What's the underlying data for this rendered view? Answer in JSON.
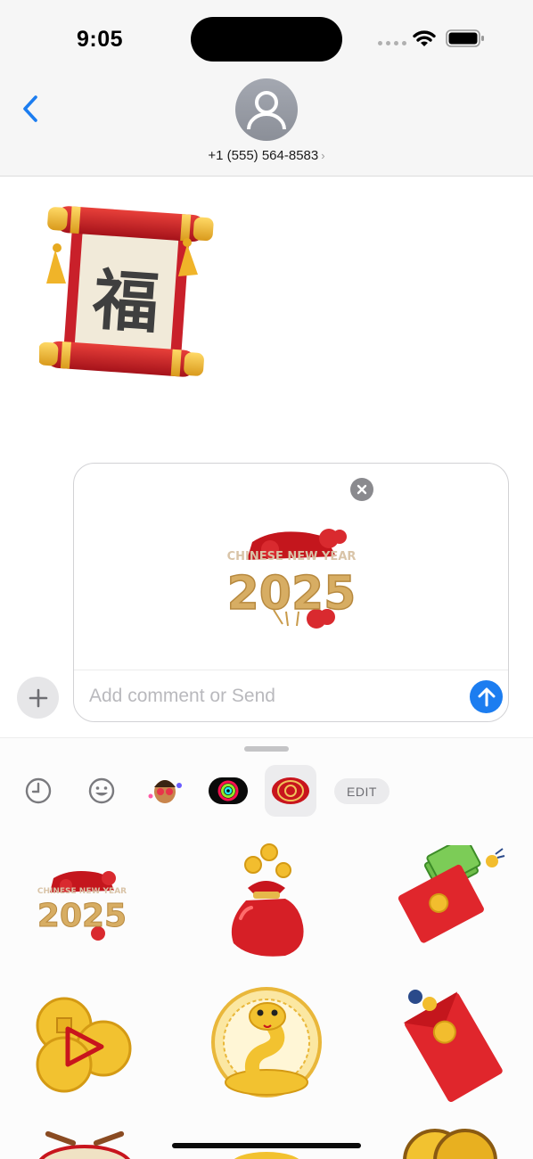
{
  "status_bar": {
    "time": "9:05"
  },
  "header": {
    "contact": "+1 (555) 564-8583"
  },
  "conversation": {
    "sent_sticker": {
      "glyph": "福"
    }
  },
  "compose": {
    "placeholder": "Add comment or Send",
    "value": "",
    "attachment": {
      "line1": "CHINESE NEW YEAR",
      "line2": "2025"
    }
  },
  "drawer": {
    "tabs": [
      {
        "icon": "recents-clock-icon",
        "selected": false
      },
      {
        "icon": "emoji-smiley-icon",
        "selected": false
      },
      {
        "icon": "memoji-icon",
        "selected": false
      },
      {
        "icon": "activity-rings-icon",
        "selected": false
      },
      {
        "icon": "lunar-new-year-pack-icon",
        "selected": true
      }
    ],
    "edit_label": "EDIT",
    "stickers": {
      "s1": {
        "line1": "CHINESE NEW YEAR",
        "line2": "2025"
      }
    }
  },
  "colors": {
    "accent": "#1c7df0",
    "sticker_red": "#d61f26",
    "sticker_gold": "#e6b84a"
  }
}
